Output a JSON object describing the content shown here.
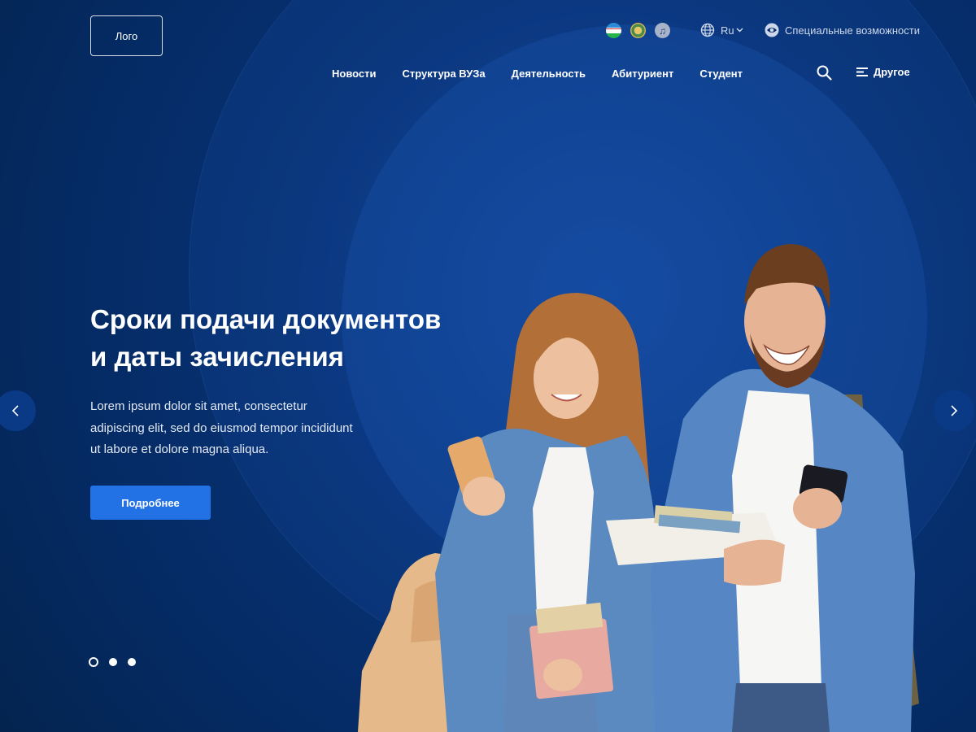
{
  "header": {
    "logo_text": "Лого",
    "language": "Ru",
    "accessibility_label": "Специальные возможности",
    "nav": [
      "Новости",
      "Структура ВУЗа",
      "Деятельность",
      "Абитуриент",
      "Студент"
    ],
    "other_label": "Другое"
  },
  "hero": {
    "title_line1": "Сроки подачи документов",
    "title_line2": "и даты зачисления",
    "description": "Lorem ipsum dolor sit amet, consectetur adipiscing elit, sed do eiusmod tempor incididunt ut labore et dolore magna aliqua.",
    "button_label": "Подробнее"
  },
  "slider": {
    "slide_count": 3,
    "active_index": 0
  },
  "icons": {
    "flag": "uzbekistan-flag-icon",
    "emblem": "state-emblem-icon",
    "anthem": "music-note-icon",
    "globe": "globe-icon",
    "eye": "eye-icon",
    "search": "search-icon",
    "menu": "menu-lines-icon",
    "prev": "chevron-left-icon",
    "next": "chevron-right-icon"
  },
  "colors": {
    "background": "#062a63",
    "accent": "#2272e6",
    "text": "#ffffff"
  }
}
